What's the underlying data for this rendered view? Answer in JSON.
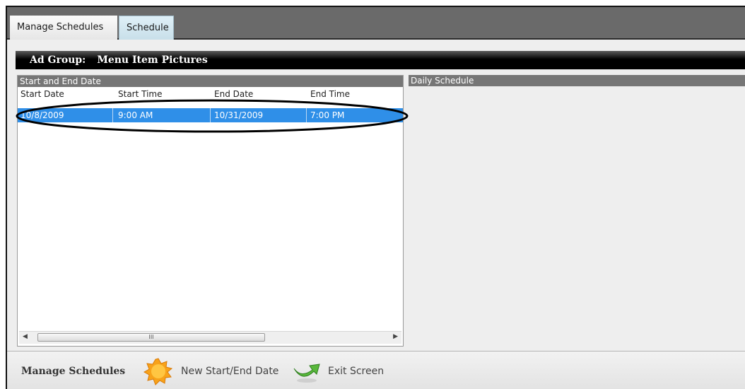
{
  "tabs": [
    {
      "label": "Manage Schedules",
      "active": false
    },
    {
      "label": "Schedule",
      "active": true
    }
  ],
  "ad_group": {
    "label": "Ad Group:",
    "value": "Menu Item Pictures"
  },
  "start_end_panel": {
    "title": "Start and End Date",
    "columns": [
      "Start Date",
      "Start Time",
      "End Date",
      "End Time"
    ],
    "rows": [
      {
        "start_date": "10/8/2009",
        "start_time": "9:00 AM",
        "end_date": "10/31/2009",
        "end_time": "7:00 PM"
      }
    ],
    "scroll_thumb_glyph": "III"
  },
  "daily_panel": {
    "title": "Daily Schedule"
  },
  "footer": {
    "title": "Manage Schedules",
    "buttons": [
      {
        "label": "New Start/End Date",
        "icon": "new-sunburst-icon"
      },
      {
        "label": "Exit Screen",
        "icon": "exit-arrow-icon"
      }
    ]
  },
  "colors": {
    "selection": "#2f8fe8",
    "header_bar": "#000000",
    "tab_active": "#d4e8f2"
  }
}
